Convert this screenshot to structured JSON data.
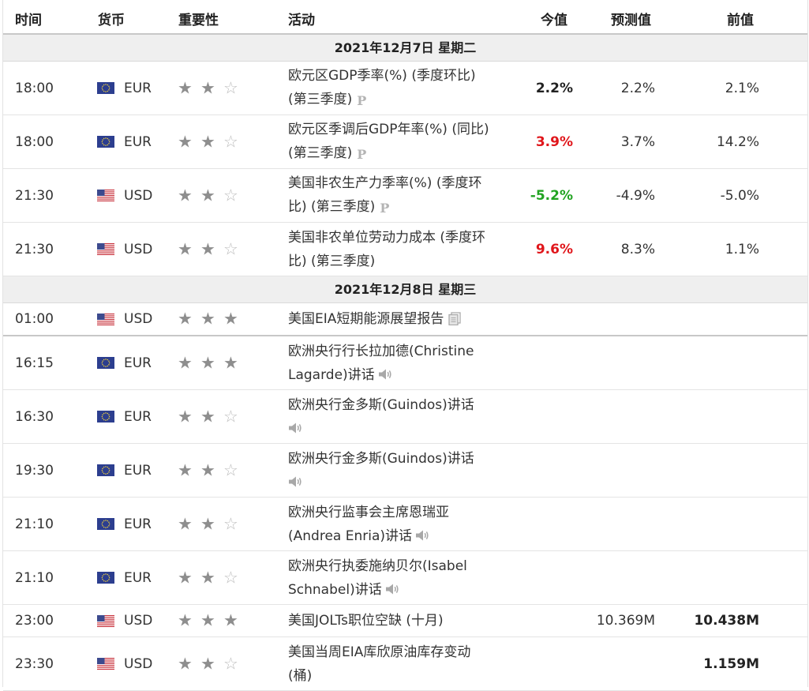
{
  "header": {
    "time": "时间",
    "currency": "货币",
    "importance": "重要性",
    "event": "活动",
    "actual": "今值",
    "forecast": "预测值",
    "previous": "前值"
  },
  "icons": {
    "flag_eur": "eu-flag",
    "flag_usd": "us-flag",
    "report": "document-icon",
    "speech": "speaker-icon",
    "preliminary": "p-icon"
  },
  "colors": {
    "positive": "#21a321",
    "negative": "#e0161b"
  },
  "days": [
    {
      "date": "2021年12月7日  星期二",
      "rows": [
        {
          "time": "18:00",
          "currency": "EUR",
          "flag": "eu",
          "stars": 2,
          "event_line1": "欧元区GDP季率(%) (季度环比)",
          "event_line2": "(第三季度)",
          "icon": "p",
          "actual": "2.2%",
          "actual_color": "black",
          "forecast": "2.2%",
          "previous": "2.1%",
          "height": 67
        },
        {
          "time": "18:00",
          "currency": "EUR",
          "flag": "eu",
          "stars": 2,
          "event_line1": "欧元区季调后GDP年率(%) (同比)",
          "event_line2": "(第三季度)",
          "icon": "p",
          "actual": "3.9%",
          "actual_color": "red",
          "forecast": "3.7%",
          "previous": "14.2%",
          "height": 67
        },
        {
          "time": "21:30",
          "currency": "USD",
          "flag": "us",
          "stars": 2,
          "event_line1": "美国非农生产力季率(%) (季度环",
          "event_line2": "比) (第三季度)",
          "icon": "p",
          "actual": "-5.2%",
          "actual_color": "green",
          "forecast": "-4.9%",
          "previous": "-5.0%",
          "height": 67
        },
        {
          "time": "21:30",
          "currency": "USD",
          "flag": "us",
          "stars": 2,
          "event_line1": "美国非农单位劳动力成本 (季度环",
          "event_line2": "比) (第三季度)",
          "icon": "",
          "actual": "9.6%",
          "actual_color": "red",
          "forecast": "8.3%",
          "previous": "1.1%",
          "height": 67
        }
      ]
    },
    {
      "date": "2021年12月8日  星期三",
      "rows": [
        {
          "time": "01:00",
          "currency": "USD",
          "flag": "us",
          "stars": 3,
          "event_line1": "美国EIA短期能源展望报告",
          "event_line2": "",
          "icon": "doc",
          "actual": "",
          "actual_color": "black",
          "forecast": "",
          "previous": "",
          "height": 40,
          "thick": true
        },
        {
          "time": "16:15",
          "currency": "EUR",
          "flag": "eu",
          "stars": 3,
          "event_line1": "欧洲央行行长拉加德(Christine",
          "event_line2": "Lagarde)讲话",
          "icon": "sound",
          "actual": "",
          "actual_color": "black",
          "forecast": "",
          "previous": "",
          "height": 67
        },
        {
          "time": "16:30",
          "currency": "EUR",
          "flag": "eu",
          "stars": 2,
          "event_line1": "欧洲央行金多斯(Guindos)讲话",
          "event_line2": "",
          "icon": "sound",
          "icon_own_line": true,
          "actual": "",
          "actual_color": "black",
          "forecast": "",
          "previous": "",
          "height": 67
        },
        {
          "time": "19:30",
          "currency": "EUR",
          "flag": "eu",
          "stars": 2,
          "event_line1": "欧洲央行金多斯(Guindos)讲话",
          "event_line2": "",
          "icon": "sound",
          "icon_own_line": true,
          "actual": "",
          "actual_color": "black",
          "forecast": "",
          "previous": "",
          "height": 67
        },
        {
          "time": "21:10",
          "currency": "EUR",
          "flag": "eu",
          "stars": 2,
          "event_line1": "欧洲央行监事会主席恩瑞亚",
          "event_line2": "(Andrea Enria)讲话",
          "icon": "sound",
          "actual": "",
          "actual_color": "black",
          "forecast": "",
          "previous": "",
          "height": 67
        },
        {
          "time": "21:10",
          "currency": "EUR",
          "flag": "eu",
          "stars": 2,
          "event_line1": "欧洲央行执委施纳贝尔(Isabel",
          "event_line2": "Schnabel)讲话",
          "icon": "sound",
          "actual": "",
          "actual_color": "black",
          "forecast": "",
          "previous": "",
          "height": 67
        },
        {
          "time": "23:00",
          "currency": "USD",
          "flag": "us",
          "stars": 3,
          "event_line1": "美国JOLTs职位空缺 (十月)",
          "event_line2": "",
          "icon": "",
          "actual": "",
          "actual_color": "black",
          "forecast": "10.369M",
          "previous": "10.438M",
          "previous_bold": true,
          "height": 40
        },
        {
          "time": "23:30",
          "currency": "USD",
          "flag": "us",
          "stars": 2,
          "event_line1": "美国当周EIA库欣原油库存变动",
          "event_line2": "(桶)",
          "icon": "",
          "actual": "",
          "actual_color": "black",
          "forecast": "",
          "previous": "1.159M",
          "previous_bold": true,
          "height": 67
        }
      ]
    }
  ]
}
